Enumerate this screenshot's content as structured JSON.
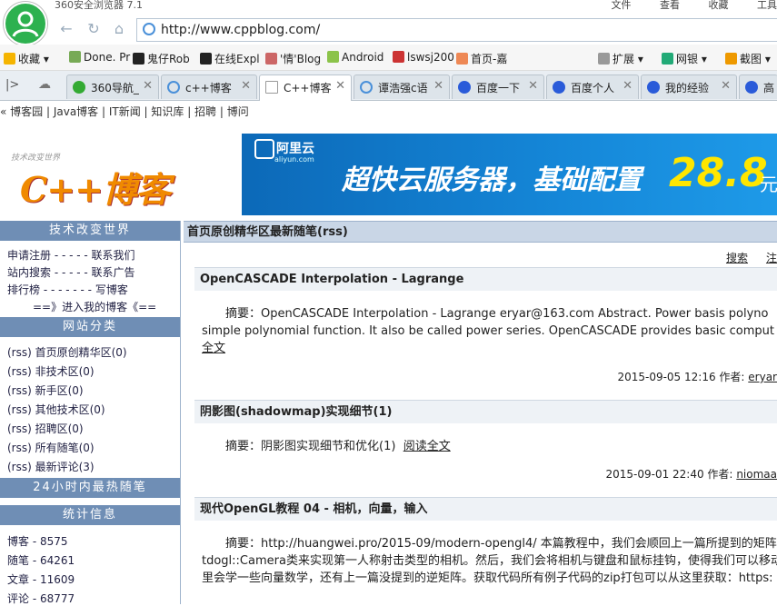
{
  "browser": {
    "title": "360安全浏览器 7.1",
    "menu": [
      "文件",
      "查看",
      "收藏",
      "工具"
    ],
    "url": "http://www.cppblog.com/"
  },
  "bookmarks": [
    {
      "label": "收藏",
      "color": "#f5b400"
    },
    {
      "label": "Done. Pr",
      "color": "#7a5"
    },
    {
      "label": "鬼仔Rob",
      "color": "#222"
    },
    {
      "label": "在线Expl",
      "color": "#222"
    },
    {
      "label": "'情'Blog",
      "color": "#c66"
    },
    {
      "label": "Android",
      "color": "#8bc34a"
    },
    {
      "label": "lswsj200",
      "color": "#c33"
    },
    {
      "label": "首页-嘉",
      "color": "#e85"
    },
    {
      "label": "扩展",
      "color": "#999"
    },
    {
      "label": "网银",
      "color": "#2a7"
    },
    {
      "label": "截图",
      "color": "#e90"
    }
  ],
  "tabs": [
    {
      "label": "360导航_",
      "color": "#3a3"
    },
    {
      "label": "c++博客",
      "color": "#4a90d9"
    },
    {
      "label": "C++博客",
      "color": "#ccc",
      "active": true
    },
    {
      "label": "谭浩强c语",
      "color": "#4a90d9"
    },
    {
      "label": "百度一下",
      "color": "#2a5bd9"
    },
    {
      "label": "百度个人",
      "color": "#2a5bd9"
    },
    {
      "label": "我的经验",
      "color": "#2a5bd9"
    },
    {
      "label": "高",
      "color": "#2a5bd9"
    }
  ],
  "sitenav": "« 博客园 | Java博客 | IT新闻 | 知识库 | 招聘 | 博问",
  "banner": {
    "logo_sub": "技术改变世界",
    "logo_main": "C++博客",
    "ad_brand": "阿里云",
    "ad_brand_sub": "aliyun.com",
    "ad_headline": "超快云服务器，基础配置",
    "ad_price": "28.8",
    "ad_unit": "元"
  },
  "sidebar": {
    "head1": "技术改变世界",
    "links": [
      "申请注册 - - - - -  联系我们",
      "站内搜索 - - - - -  联系广告",
      "排行榜 - - - - - - -  写博客",
      "==》进入我的博客《=="
    ],
    "head2": "网站分类",
    "categories": [
      "(rss) 首页原创精华区(0)",
      "(rss) 非技术区(0)",
      "(rss) 新手区(0)",
      "(rss) 其他技术区(0)",
      "(rss) 招聘区(0)",
      "(rss) 所有随笔(0)",
      "(rss) 最新评论(3)"
    ],
    "head3": "24小时内最热随笔",
    "head4": "统计信息",
    "stats": [
      "博客 - 8575",
      "随笔 - 64261",
      "文章 - 11609",
      "评论 - 68777"
    ]
  },
  "main": {
    "head": "首页原创精华区最新随笔(rss)",
    "search": "搜索",
    "search2": "注",
    "posts": [
      {
        "title": "OpenCASCADE Interpolation - Lagrange",
        "line1": "摘要：OpenCASCADE Interpolation - Lagrange eryar@163.com Abstract. Power basis polyno",
        "line2": "simple polynomial function. It also be called power series. OpenCASCADE provides basic comput",
        "more": "全文",
        "date": "2015-09-05 12:16 作者:",
        "author": "eryar"
      },
      {
        "title": "阴影图(shadowmap)实现细节(1)",
        "line1": "摘要：阴影图实现细节和优化(1)",
        "more": "阅读全文",
        "date": "2015-09-01 22:40 作者:",
        "author": "niomaa"
      },
      {
        "title": "现代OpenGL教程 04 - 相机，向量，输入",
        "line1": "摘要：http://huangwei.pro/2015-09/modern-opengl4/ 本篇教程中，我们会顺回上一篇所提到的矩阵",
        "line2": "tdogl::Camera类来实现第一人称射击类型的相机。然后，我们会将相机与键盘和鼠标挂钩，使得我们可以移动",
        "line3": "里会学一些向量数学，还有上一篇没提到的逆矩阵。获取代码所有例子代码的zip打包可以从这里获取：https:"
      }
    ]
  }
}
